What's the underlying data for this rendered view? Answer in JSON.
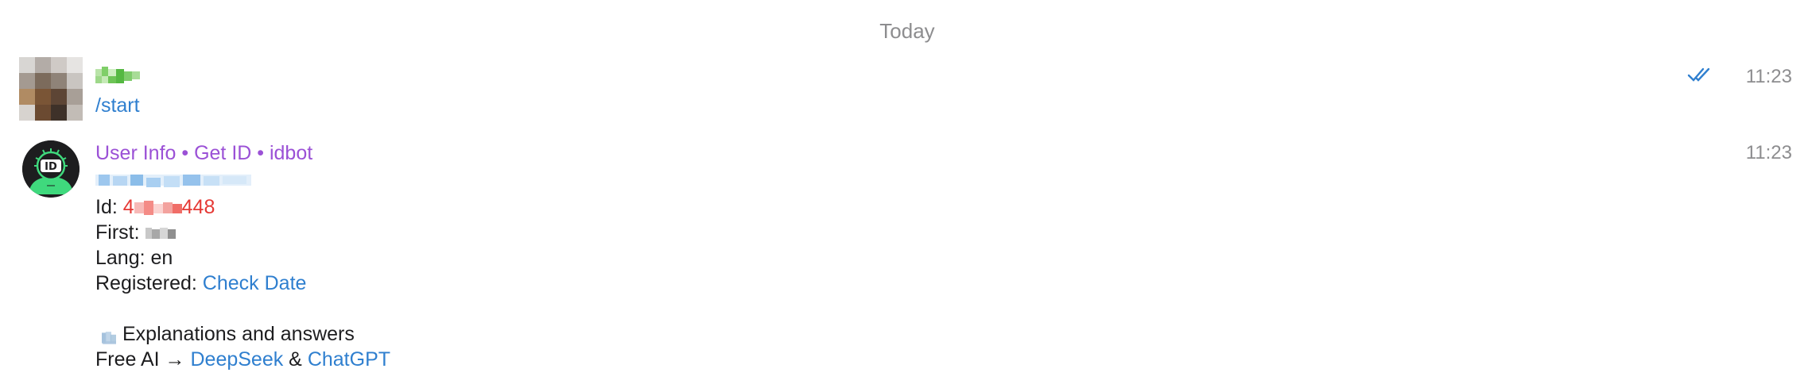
{
  "day_separator": "Today",
  "messages": [
    {
      "sender": "",
      "text": "/start",
      "time": "11:23",
      "status": "read",
      "colors": {
        "text": "#2f7fcf",
        "check": "#2f7fcf"
      }
    },
    {
      "sender": "User Info • Get ID • idbot",
      "sender_color": "#9b51d6",
      "time": "11:23",
      "lines": {
        "id_label": "Id: ",
        "id_value_start": "4",
        "id_value_end": "448",
        "first_label": "First: ",
        "lang": "Lang: en",
        "registered_label": "Registered: ",
        "registered_link": "Check Date",
        "explanations": "Explanations and answers",
        "free_ai_prefix": "Free AI → ",
        "deepseek": "DeepSeek",
        "amp": " & ",
        "chatgpt": "ChatGPT"
      }
    }
  ],
  "colors": {
    "link": "#2f7fcf",
    "accent_purple": "#9b51d6",
    "id_red": "#e53935",
    "meta_gray": "#8d8d8f"
  },
  "icons": [
    "double-check-icon",
    "bot-id-avatar-icon",
    "books-emoji-icon"
  ]
}
